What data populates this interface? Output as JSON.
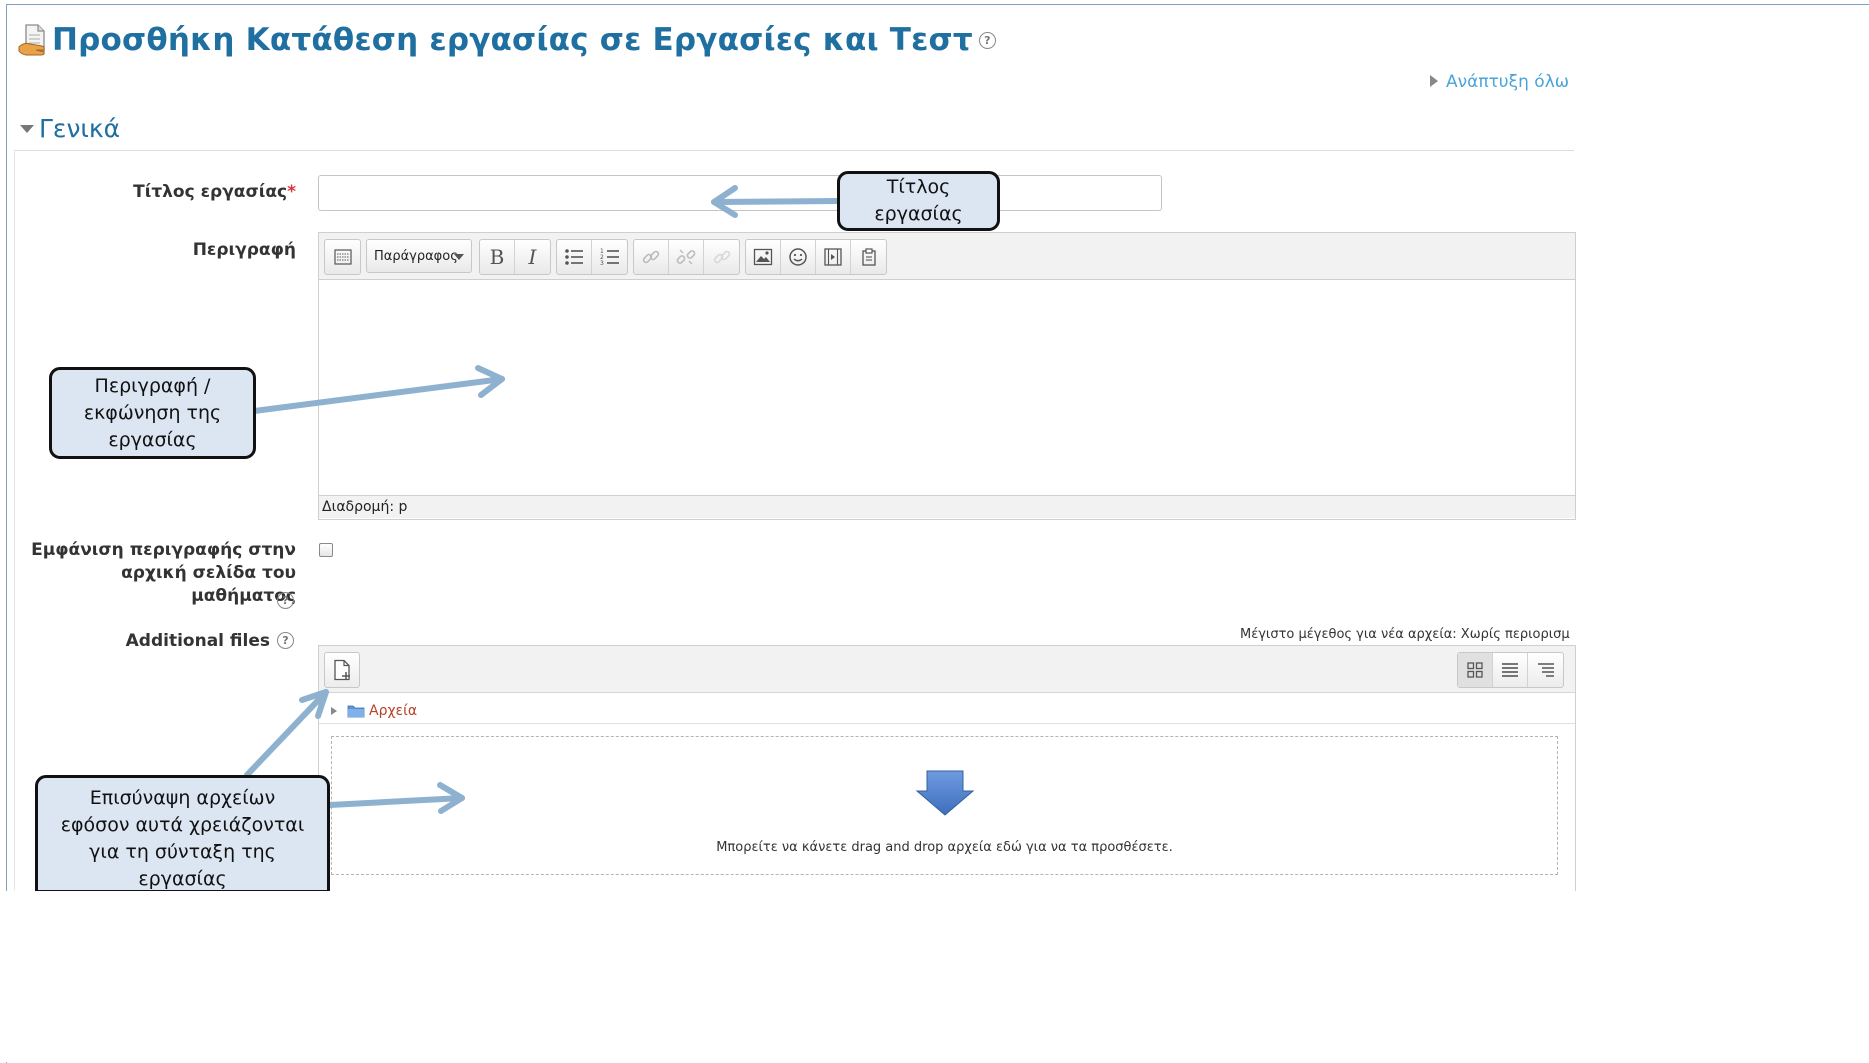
{
  "header": {
    "title": "Προσθήκη Κατάθεση εργασίας σε Εργασίες και Τεστ",
    "help_symbol": "?"
  },
  "expand_all": "Ανάπτυξη όλων",
  "section": {
    "legend": "Γενικά"
  },
  "form": {
    "title_label": "Τίτλος εργασίας",
    "required_mark": "*",
    "title_value": "",
    "description_label": "Περιγραφή",
    "show_description_label_line1": "Εμφάνιση περιγραφής στην",
    "show_description_label_line2": "αρχική σελίδα του μαθήματος",
    "show_description_checked": false,
    "additional_files_label": "Additional files"
  },
  "editor": {
    "paragraph_select": "Παράγραφος",
    "bold": "B",
    "italic": "I",
    "path_status": "Διαδρομή: p",
    "toolbar_icons": [
      "toolbar-toggle-icon",
      "paragraph-select",
      "bold-icon",
      "italic-icon",
      "unordered-list-icon",
      "ordered-list-icon",
      "link-icon",
      "unlink-icon",
      "anchor-link-icon",
      "image-icon",
      "emoticon-icon",
      "media-icon",
      "paste-icon"
    ]
  },
  "filemanager": {
    "max_size": "Μέγιστο μέγεθος για νέα αρχεία: Χωρίς περιορισμό",
    "folder_name": "Αρχεία",
    "dropzone_text": "Μπορείτε να κάνετε drag and drop αρχεία εδώ για να τα προσθέσετε."
  },
  "callouts": {
    "title": [
      "Τίτλος",
      "εργασίας"
    ],
    "description": [
      "Περιγραφή /",
      "εκφώνηση της",
      "εργασίας"
    ],
    "attach": [
      "Επισύναψη αρχείων",
      "εφόσον αυτά χρειάζονται",
      "για τη σύνταξη της",
      "εργασίας"
    ]
  },
  "colors": {
    "title_blue": "#1f6fa0",
    "link_blue": "#4aa4d8",
    "callout_fill": "#dce6f2",
    "arrow_blue": "#8eb1cf",
    "dropzone_arrow": "#4f81c8",
    "required_red": "#d9343c",
    "folder_text": "#b5442b"
  }
}
